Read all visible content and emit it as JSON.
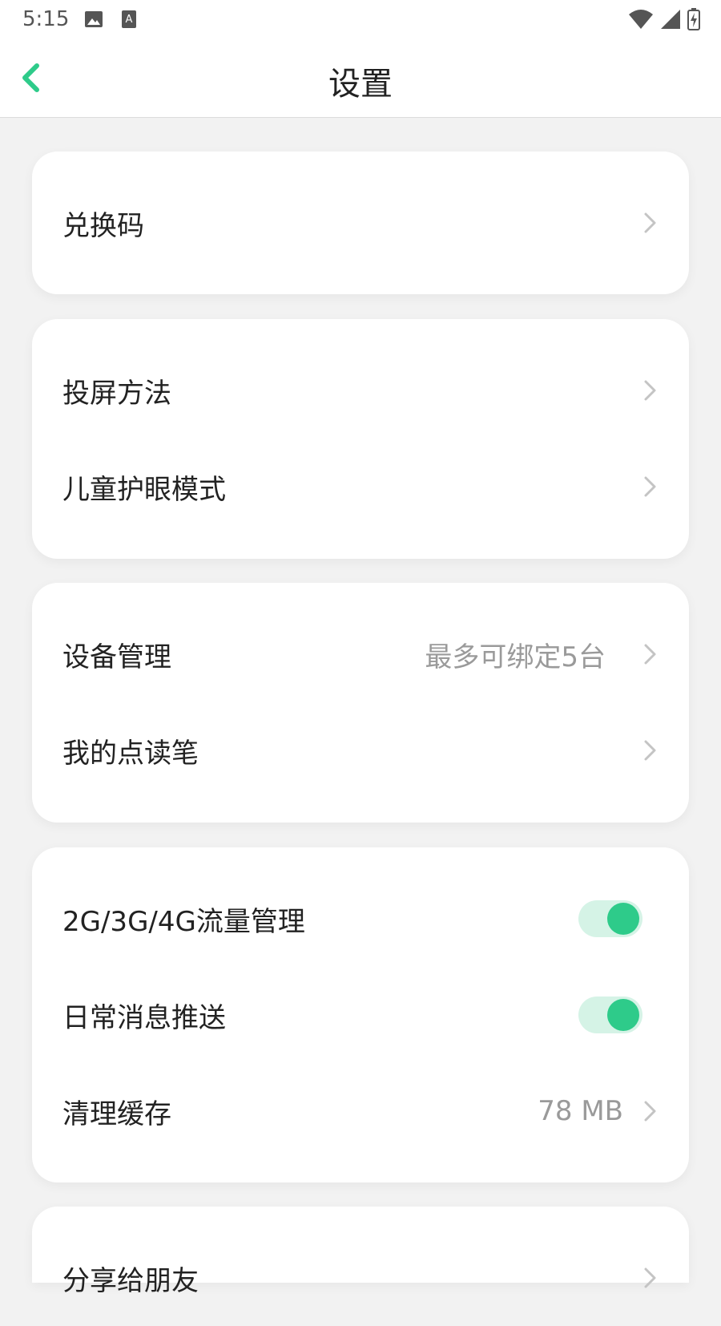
{
  "status_bar": {
    "time": "5:15",
    "icons": [
      "image-icon",
      "a-icon",
      "wifi-icon",
      "signal-icon",
      "battery-icon"
    ]
  },
  "app_bar": {
    "title": "设置",
    "back_icon": "chevron-left-icon",
    "accent_color": "#2ecb8a"
  },
  "cards": [
    {
      "items": [
        {
          "label": "兑换码"
        }
      ]
    },
    {
      "items": [
        {
          "label": "投屏方法"
        },
        {
          "label": "儿童护眼模式"
        }
      ]
    },
    {
      "items": [
        {
          "label": "设备管理",
          "value": "最多可绑定5台"
        },
        {
          "label": "我的点读笔"
        }
      ]
    },
    {
      "items": [
        {
          "label": "2G/3G/4G流量管理",
          "toggle": true
        },
        {
          "label": "日常消息推送",
          "toggle": true
        },
        {
          "label": "清理缓存",
          "value": "78 MB"
        }
      ]
    },
    {
      "items": [
        {
          "label": "分享给朋友"
        }
      ]
    }
  ]
}
